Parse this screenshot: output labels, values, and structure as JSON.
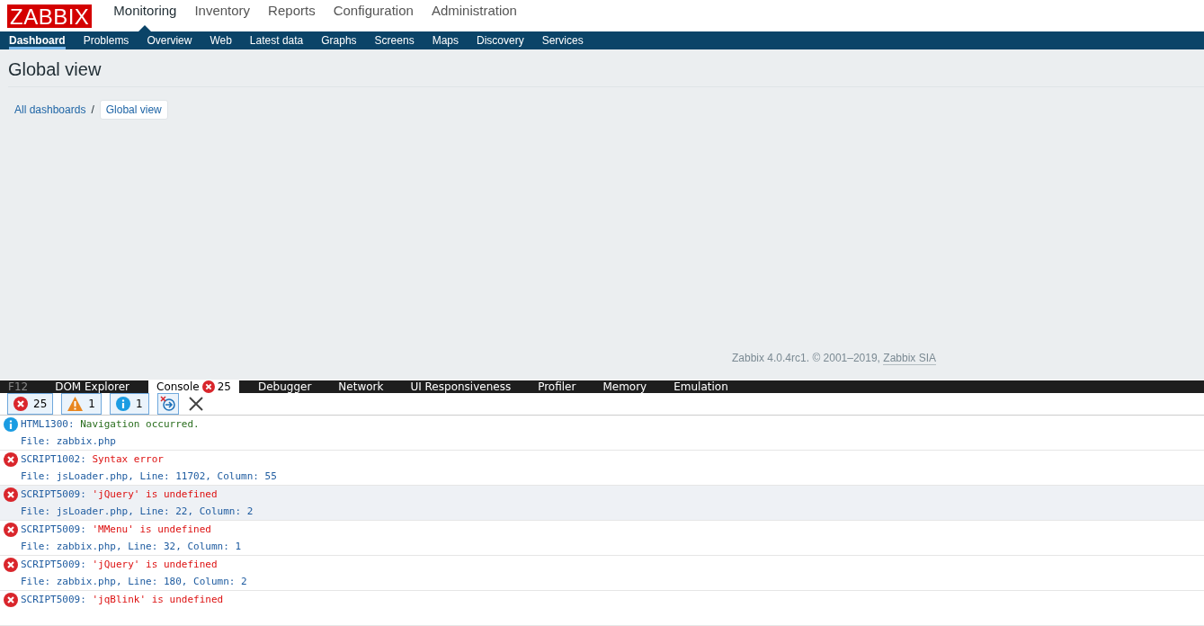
{
  "logo": "ZABBIX",
  "main_menu": [
    {
      "label": "Monitoring",
      "selected": true
    },
    {
      "label": "Inventory",
      "selected": false
    },
    {
      "label": "Reports",
      "selected": false
    },
    {
      "label": "Configuration",
      "selected": false
    },
    {
      "label": "Administration",
      "selected": false
    }
  ],
  "sub_menu": [
    {
      "label": "Dashboard",
      "selected": true
    },
    {
      "label": "Problems",
      "selected": false
    },
    {
      "label": "Overview",
      "selected": false
    },
    {
      "label": "Web",
      "selected": false
    },
    {
      "label": "Latest data",
      "selected": false
    },
    {
      "label": "Graphs",
      "selected": false
    },
    {
      "label": "Screens",
      "selected": false
    },
    {
      "label": "Maps",
      "selected": false
    },
    {
      "label": "Discovery",
      "selected": false
    },
    {
      "label": "Services",
      "selected": false
    }
  ],
  "page_title": "Global view",
  "breadcrumbs": {
    "link": "All dashboards",
    "separator": "/",
    "current": "Global view"
  },
  "footer": {
    "text": "Zabbix 4.0.4rc1. © 2001–2019, ",
    "link": "Zabbix SIA"
  },
  "devtools": {
    "tabs": [
      {
        "label": "F12",
        "selected": false,
        "disabled": true
      },
      {
        "label": "DOM Explorer",
        "selected": false,
        "disabled": false
      },
      {
        "label": "Console",
        "selected": true,
        "disabled": false,
        "error_count": "25"
      },
      {
        "label": "Debugger",
        "selected": false,
        "disabled": false
      },
      {
        "label": "Network",
        "selected": false,
        "disabled": false
      },
      {
        "label": "UI Responsiveness",
        "selected": false,
        "disabled": false
      },
      {
        "label": "Profiler",
        "selected": false,
        "disabled": false
      },
      {
        "label": "Memory",
        "selected": false,
        "disabled": false
      },
      {
        "label": "Emulation",
        "selected": false,
        "disabled": false
      }
    ],
    "filters": [
      {
        "kind": "error",
        "count": "25",
        "selected": true
      },
      {
        "kind": "warning",
        "count": "1",
        "selected": true
      },
      {
        "kind": "info",
        "count": "1",
        "selected": true
      }
    ],
    "messages": [
      {
        "kind": "info",
        "code": "HTML1300:",
        "text": "Navigation occurred.",
        "file": "File: zabbix.php",
        "selected": false
      },
      {
        "kind": "error",
        "code": "SCRIPT1002:",
        "text": "Syntax error",
        "file": "File: jsLoader.php, Line: 11702, Column: 55",
        "selected": false
      },
      {
        "kind": "error",
        "code": "SCRIPT5009:",
        "text": "'jQuery' is undefined",
        "file": "File: jsLoader.php, Line: 22, Column: 2",
        "selected": true
      },
      {
        "kind": "error",
        "code": "SCRIPT5009:",
        "text": "'MMenu' is undefined",
        "file": "File: zabbix.php, Line: 32, Column: 1",
        "selected": false
      },
      {
        "kind": "error",
        "code": "SCRIPT5009:",
        "text": "'jQuery' is undefined",
        "file": "File: zabbix.php, Line: 180, Column: 2",
        "selected": false
      },
      {
        "kind": "error",
        "code": "SCRIPT5009:",
        "text": "'jqBlink' is undefined",
        "selected": false
      }
    ]
  }
}
